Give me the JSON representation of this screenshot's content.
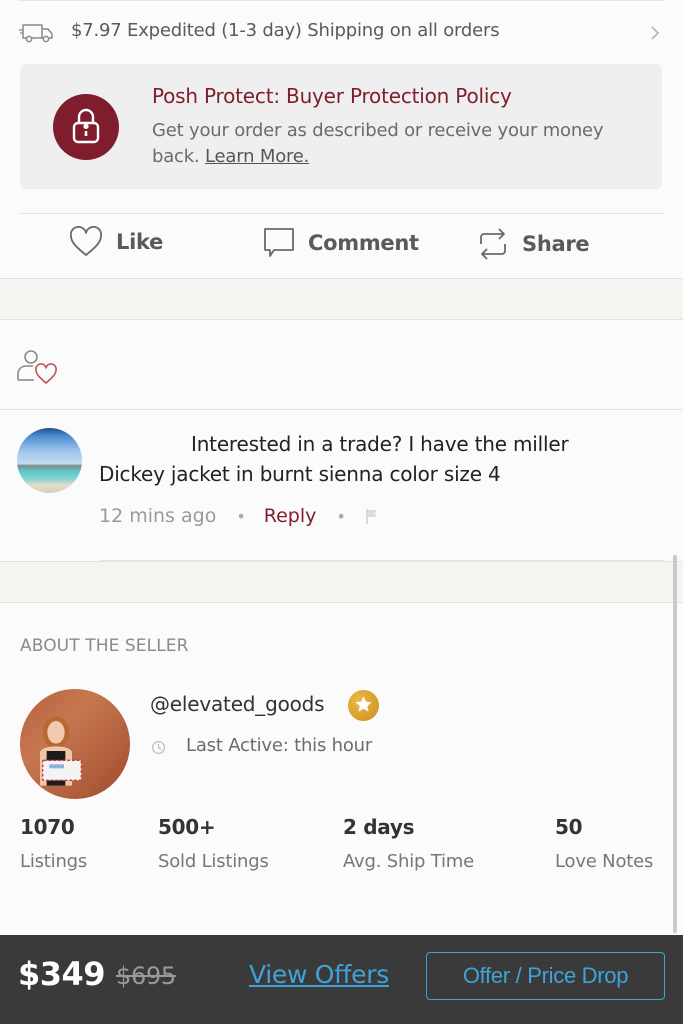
{
  "shipping": {
    "icon": "truck-icon",
    "text": "$7.97 Expedited (1-3 day) Shipping on all orders",
    "chevron": "chevron-right-icon"
  },
  "protect": {
    "icon": "lock-icon",
    "title": "Posh Protect: Buyer Protection Policy",
    "description": "Get your order as described or receive your money back.",
    "learn_more": "Learn More.",
    "accent_color": "#7f1d2d"
  },
  "actions": [
    {
      "icon": "heart-icon",
      "label": "Like"
    },
    {
      "icon": "comment-icon",
      "label": "Comment"
    },
    {
      "icon": "share-icon",
      "label": "Share"
    }
  ],
  "likers": {
    "icon": "user-heart-icon"
  },
  "comment": {
    "text_line1": "Interested in a trade? I have the miller",
    "text_line2": "Dickey jacket in burnt sienna color size 4",
    "time": "12 mins ago",
    "reply_label": "Reply",
    "flag_icon": "flag-icon"
  },
  "seller": {
    "heading": "ABOUT THE SELLER",
    "username": "@elevated_goods",
    "badge_icon": "star-badge-icon",
    "last_active": "Last Active: this hour",
    "stats": [
      {
        "value": "1070",
        "label": "Listings"
      },
      {
        "value": "500+",
        "label": "Sold Listings"
      },
      {
        "value": "2 days",
        "label": "Avg. Ship Time"
      },
      {
        "value": "50",
        "label": "Love Notes"
      }
    ]
  },
  "bottom_bar": {
    "price": "$349",
    "original_price": "$695",
    "view_offers": "View Offers",
    "offer_button": "Offer / Price Drop",
    "link_color": "#3fa3d9"
  }
}
